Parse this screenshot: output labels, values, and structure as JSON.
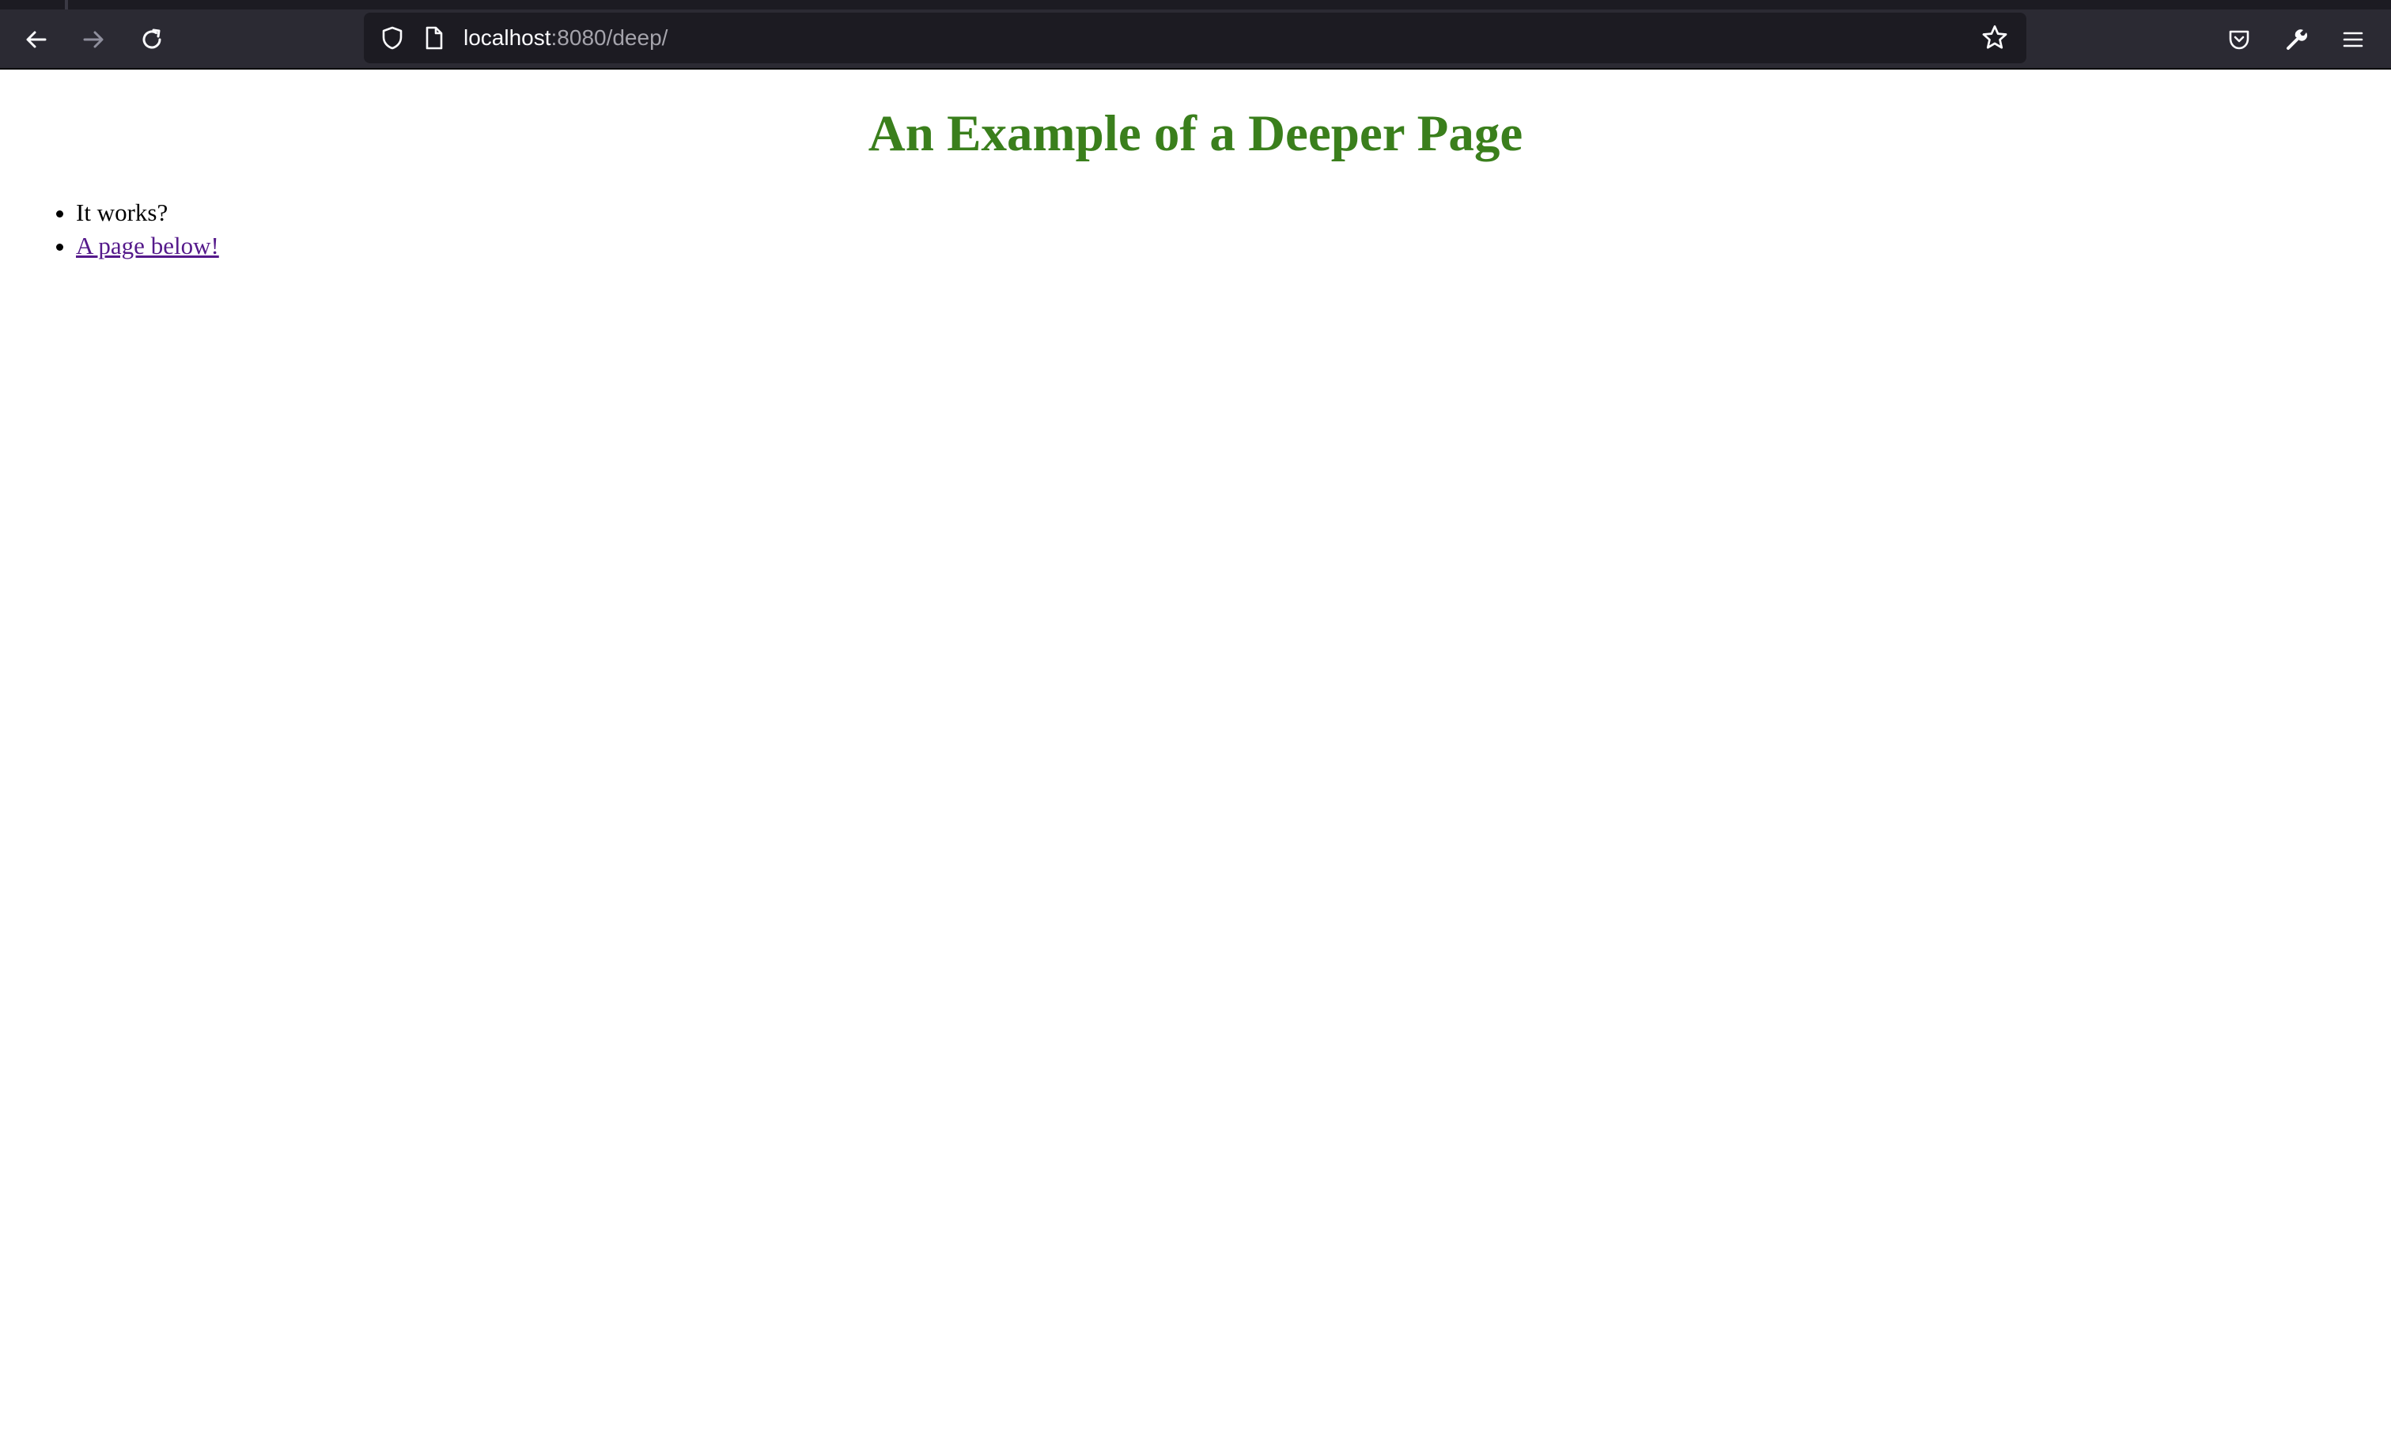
{
  "browser": {
    "url_host": "localhost",
    "url_rest": ":8080/deep/",
    "icons": {
      "back": "back-arrow-icon",
      "forward": "forward-arrow-icon",
      "reload": "reload-icon",
      "shield": "shield-icon",
      "page": "page-icon",
      "bookmark": "star-icon",
      "pocket": "pocket-icon",
      "tools": "wrench-icon",
      "menu": "hamburger-menu-icon"
    },
    "colors": {
      "toolbar": "#2b2a33",
      "urlbar": "#1c1b22"
    }
  },
  "page": {
    "title": "An Example of a Deeper Page",
    "title_color": "#3a7f1c",
    "items": [
      {
        "text": "It works?"
      },
      {
        "text": "A page below!",
        "is_link": true
      }
    ],
    "link_color": "#551a8b"
  }
}
